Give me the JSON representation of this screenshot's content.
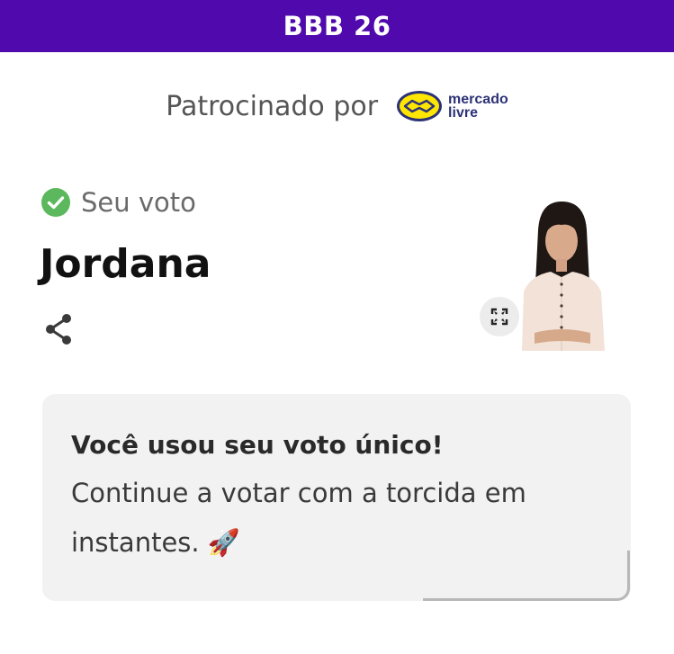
{
  "header": {
    "title": "BBB 26",
    "bg_color": "#5009ac"
  },
  "sponsor": {
    "label": "Patrocinado por",
    "logo_name": "mercado-livre-logo",
    "logo_text": "mercado livre",
    "logo_color": "#ffe600"
  },
  "vote": {
    "status_icon": "check-circle-icon",
    "status_color": "#5cb85c",
    "status_label": "Seu voto",
    "candidate_name": "Jordana",
    "share_icon": "share-icon",
    "expand_icon": "expand-icon"
  },
  "card": {
    "title": "Você usou seu voto único!",
    "message": "Continue a votar com a torcida em instantes. 🚀"
  }
}
